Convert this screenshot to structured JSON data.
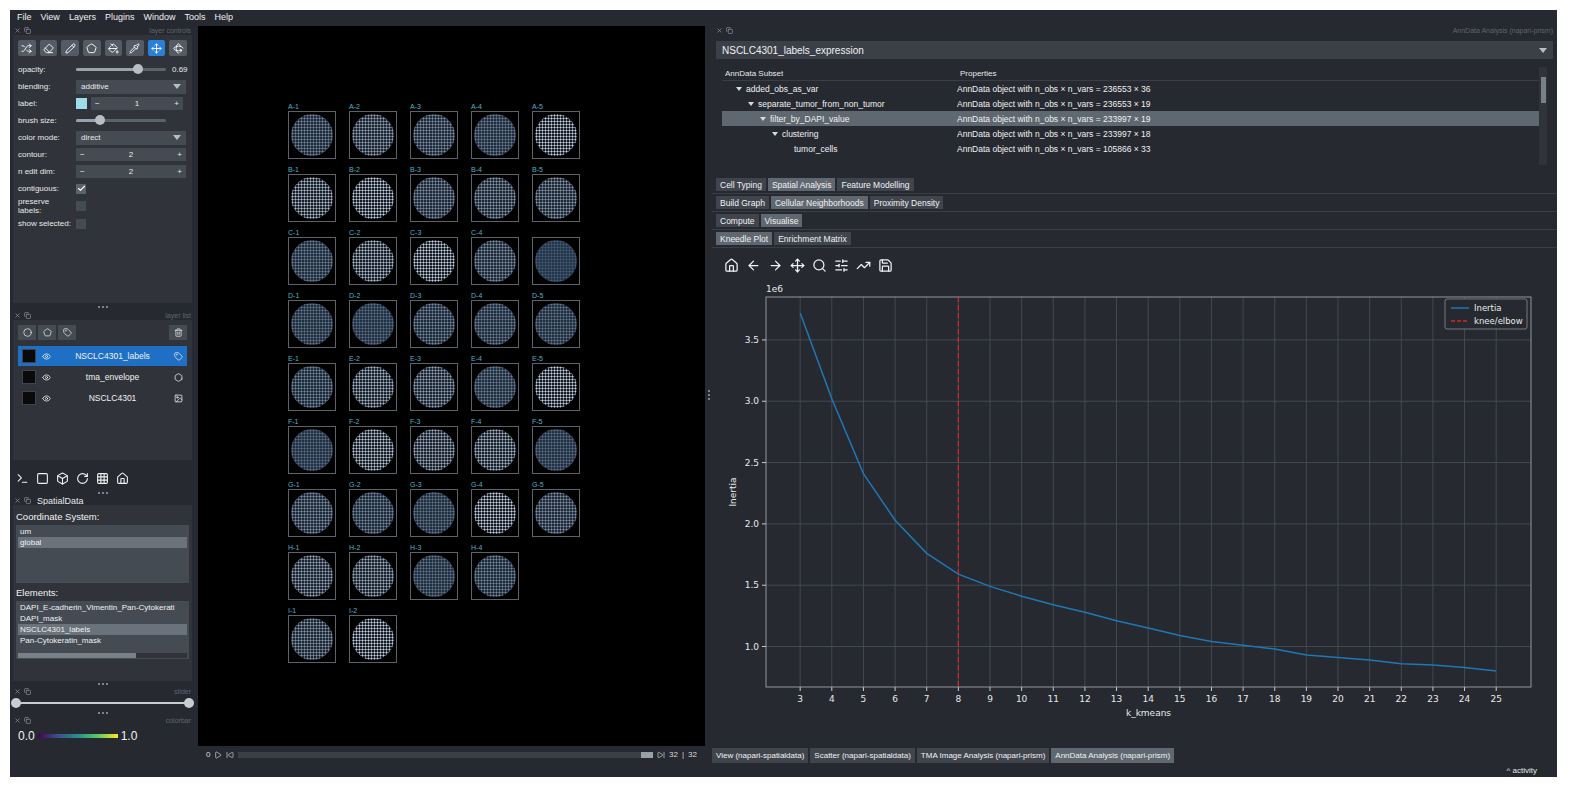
{
  "menu": [
    "File",
    "View",
    "Layers",
    "Plugins",
    "Window",
    "Tools",
    "Help"
  ],
  "layer_controls": {
    "title": "layer controls",
    "tools": [
      {
        "selected": false
      },
      {
        "selected": false
      },
      {
        "selected": false
      },
      {
        "selected": false
      },
      {
        "selected": false
      },
      {
        "selected": false
      },
      {
        "selected": true
      },
      {
        "selected": false
      }
    ],
    "rows": [
      {
        "kind": "slider",
        "label": "opacity:",
        "level": 0.69,
        "value": "0.69"
      },
      {
        "kind": "select",
        "label": "blending:",
        "value": "additive"
      },
      {
        "kind": "label",
        "label": "label:",
        "value": "1",
        "color": "#9fdcea",
        "minus": "−",
        "plus": "+"
      },
      {
        "kind": "slider",
        "label": "brush size:",
        "level": 0.27
      },
      {
        "kind": "select",
        "label": "color mode:",
        "value": "direct"
      },
      {
        "kind": "spin",
        "label": "contour:",
        "value": "2",
        "minus": "−",
        "plus": "+"
      },
      {
        "kind": "spin",
        "label": "n edit dim:",
        "value": "2",
        "minus": "−",
        "plus": "+"
      },
      {
        "kind": "checkbox",
        "label": "contiguous:",
        "checked": true
      },
      {
        "kind": "checkbox",
        "label": "preserve labels:",
        "checked": false
      },
      {
        "kind": "checkbox",
        "label": "show selected:",
        "checked": false
      }
    ]
  },
  "layer_list": {
    "title": "layer list",
    "layers": [
      {
        "name": "NSCLC4301_labels",
        "kind": "labels",
        "visible": true,
        "selected": true
      },
      {
        "name": "tma_envelope",
        "kind": "shapes",
        "visible": true,
        "selected": false
      },
      {
        "name": "NSCLC4301",
        "kind": "image",
        "visible": true,
        "selected": false
      }
    ]
  },
  "spatialdata": {
    "title": "SpatialData",
    "coordinate_label": "Coordinate System:",
    "coordinate_systems": [
      {
        "name": "um",
        "selected": false
      },
      {
        "name": "global",
        "selected": true
      }
    ],
    "elements_label": "Elements:",
    "elements": [
      {
        "name": "DAPI_E-cadherin_Vimentin_Pan-Cytokerati",
        "selected": false
      },
      {
        "name": "DAPI_mask",
        "selected": false
      },
      {
        "name": "NSCLC4301_labels",
        "selected": true
      },
      {
        "name": "Pan-Cytokeratin_mask",
        "selected": false
      }
    ]
  },
  "slider": {
    "title": "slider",
    "low": 0,
    "high": 1
  },
  "colorbar": {
    "title": "colorbar",
    "min": "0.0",
    "max": "1.0"
  },
  "canvas": {
    "core_rows": [
      [
        {
          "label": "A-1",
          "level": 0.45
        },
        {
          "label": "A-2",
          "level": 0.6
        },
        {
          "label": "A-3",
          "level": 0.5
        },
        {
          "label": "A-4",
          "level": 0.4
        },
        {
          "label": "A-5",
          "level": 0.85
        }
      ],
      [
        {
          "label": "B-1",
          "level": 0.75
        },
        {
          "label": "B-2",
          "level": 0.85
        },
        {
          "label": "B-3",
          "level": 0.5
        },
        {
          "label": "B-4",
          "level": 0.55
        },
        {
          "label": "B-5",
          "level": 0.55
        }
      ],
      [
        {
          "label": "C-1",
          "level": 0.4
        },
        {
          "label": "C-2",
          "level": 0.75
        },
        {
          "label": "C-3",
          "level": 0.85
        },
        {
          "label": "C-4",
          "level": 0.5
        },
        {
          "level": 0.2
        }
      ],
      [
        {
          "label": "D-1",
          "level": 0.35
        },
        {
          "label": "D-2",
          "level": 0.3
        },
        {
          "label": "D-3",
          "level": 0.45
        },
        {
          "label": "D-4",
          "level": 0.4
        },
        {
          "label": "D-5",
          "level": 0.35
        }
      ],
      [
        {
          "label": "E-1",
          "level": 0.45
        },
        {
          "label": "E-2",
          "level": 0.7
        },
        {
          "label": "E-3",
          "level": 0.6
        },
        {
          "label": "E-4",
          "level": 0.4
        },
        {
          "label": "E-5",
          "level": 0.85
        }
      ],
      [
        {
          "label": "F-1",
          "level": 0.3
        },
        {
          "label": "F-2",
          "level": 0.8
        },
        {
          "label": "F-3",
          "level": 0.65
        },
        {
          "label": "F-4",
          "level": 0.7
        },
        {
          "label": "F-5",
          "level": 0.3
        }
      ],
      [
        {
          "label": "G-1",
          "level": 0.5
        },
        {
          "label": "G-2",
          "level": 0.45
        },
        {
          "label": "G-3",
          "level": 0.35
        },
        {
          "label": "G-4",
          "level": 0.85
        },
        {
          "label": "G-5",
          "level": 0.5
        }
      ],
      [
        {
          "label": "H-1",
          "level": 0.6
        },
        {
          "label": "H-2",
          "level": 0.65
        },
        {
          "label": "H-3",
          "level": 0.35
        },
        {
          "label": "H-4",
          "level": 0.45
        }
      ],
      [
        {
          "label": "I-1",
          "level": 0.55
        },
        {
          "label": "I-2",
          "level": 0.85
        }
      ]
    ],
    "dims": {
      "start": "0",
      "current": "32",
      "separator": "|",
      "total": "32",
      "level": 1
    }
  },
  "analysis": {
    "title": "AnnData Analysis (napari-prism)",
    "dataset": "NSCLC4301_labels_expression",
    "tree": {
      "columns": [
        "AnnData Subset",
        "Properties"
      ],
      "rows": [
        {
          "name": "added_obs_as_var",
          "depth": 0,
          "expanded": true,
          "selected": false,
          "properties": "AnnData object with n_obs × n_vars = 236553 × 36"
        },
        {
          "name": "separate_tumor_from_non_tumor",
          "depth": 1,
          "expanded": true,
          "selected": false,
          "properties": "AnnData object with n_obs × n_vars = 236553 × 19"
        },
        {
          "name": "filter_by_DAPI_value",
          "depth": 2,
          "expanded": true,
          "selected": true,
          "properties": "AnnData object with n_obs × n_vars = 233997 × 19"
        },
        {
          "name": "clustering",
          "depth": 3,
          "expanded": true,
          "selected": false,
          "properties": "AnnData object with n_obs × n_vars = 233997 × 18"
        },
        {
          "name": "tumor_cells",
          "depth": 4,
          "expanded": false,
          "selected": false,
          "properties": "AnnData object with n_obs × n_vars = 105866 × 33"
        }
      ]
    },
    "tab_rows": [
      [
        {
          "label": "Cell Typing",
          "selected": false
        },
        {
          "label": "Spatial Analysis",
          "selected": true
        },
        {
          "label": "Feature Modelling",
          "selected": false
        }
      ],
      [
        {
          "label": "Build Graph",
          "selected": false
        },
        {
          "label": "Cellular Neighborhoods",
          "selected": true
        },
        {
          "label": "Proximity Density",
          "selected": false
        }
      ],
      [
        {
          "label": "Compute",
          "selected": false
        },
        {
          "label": "Visualise",
          "selected": true
        }
      ],
      [
        {
          "label": "Kneedle Plot",
          "selected": true
        },
        {
          "label": "Enrichment Matrix",
          "selected": false
        }
      ]
    ],
    "chart": {
      "exponent": "1e6",
      "y_label": "Inertia",
      "x_label": "k_kmeans",
      "y_ticks": [
        "1.0",
        "1.5",
        "2.0",
        "2.5",
        "3.0",
        "3.5"
      ],
      "x_ticks": [
        "3",
        "4",
        "5",
        "6",
        "7",
        "8",
        "9",
        "10",
        "11",
        "12",
        "13",
        "14",
        "15",
        "16",
        "17",
        "18",
        "19",
        "20",
        "21",
        "22",
        "23",
        "24",
        "25"
      ],
      "k": [
        3,
        4,
        5,
        6,
        7,
        8,
        9,
        10,
        11,
        12,
        13,
        14,
        15,
        16,
        17,
        18,
        19,
        20,
        21,
        22,
        23,
        24,
        25
      ],
      "series": [
        {
          "name": "Inertia",
          "color": "#1f77b4",
          "values": [
            3.72,
            3.02,
            2.41,
            2.03,
            1.76,
            1.59,
            1.49,
            1.41,
            1.34,
            1.28,
            1.21,
            1.15,
            1.09,
            1.04,
            1.01,
            0.98,
            0.93,
            0.91,
            0.89,
            0.86,
            0.85,
            0.83,
            0.8
          ]
        }
      ],
      "knee": {
        "name": "knee/elbow",
        "k": 8,
        "color": "#d62728"
      }
    }
  },
  "dock_tabs": [
    {
      "label": "View (napari-spatialdata)",
      "selected": false
    },
    {
      "label": "Scatter (napari-spatialdata)",
      "selected": false
    },
    {
      "label": "TMA Image Analysis (napari-prism)",
      "selected": false
    },
    {
      "label": "AnnData Analysis (napari-prism)",
      "selected": true
    }
  ],
  "status": "^ activity"
}
